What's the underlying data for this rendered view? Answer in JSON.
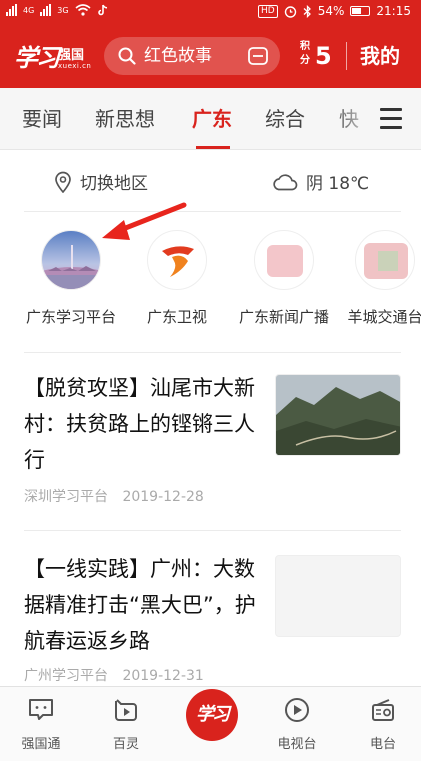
{
  "status_bar": {
    "network_left": "4G",
    "network_right": "3G",
    "carrier_icon": "tiktok-icon",
    "hd_label": "HD",
    "battery": "54%",
    "time": "21:15"
  },
  "header": {
    "logo_script": "学习",
    "logo_name": "强国",
    "logo_domain": "xuexi.cn",
    "search_text": "红色故事",
    "points_label": "积分",
    "points_value": "5",
    "mine": "我的"
  },
  "tabs": {
    "items": [
      "要闻",
      "新思想",
      "广东",
      "综合",
      "快"
    ],
    "active": "广东"
  },
  "region": {
    "switch_label": "切换地区",
    "weather_text": "阴 18℃"
  },
  "platforms": [
    {
      "name": "广东学习平台"
    },
    {
      "name": "广东卫视"
    },
    {
      "name": "广东新闻广播"
    },
    {
      "name": "羊城交通台"
    }
  ],
  "articles": [
    {
      "title": "【脱贫攻坚】汕尾市大新村：扶贫路上的铿锵三人行",
      "source": "深圳学习平台",
      "date": "2019-12-28"
    },
    {
      "title": "【一线实践】广州：大数据精准打击“黑大巴”，护航春运返乡路",
      "source": "广州学习平台",
      "date": "2019-12-31"
    }
  ],
  "bottom_nav": {
    "items": [
      {
        "label": "强国通",
        "icon": "chat-icon"
      },
      {
        "label": "百灵",
        "icon": "bailing-icon"
      },
      {
        "label": "学习",
        "icon": "xuexi-logo"
      },
      {
        "label": "电视台",
        "icon": "play-icon"
      },
      {
        "label": "电台",
        "icon": "radio-icon"
      }
    ]
  },
  "colors": {
    "brand_red": "#d9231d",
    "tab_bg": "#f6f6f6",
    "meta_gray": "#aaaaaa"
  }
}
